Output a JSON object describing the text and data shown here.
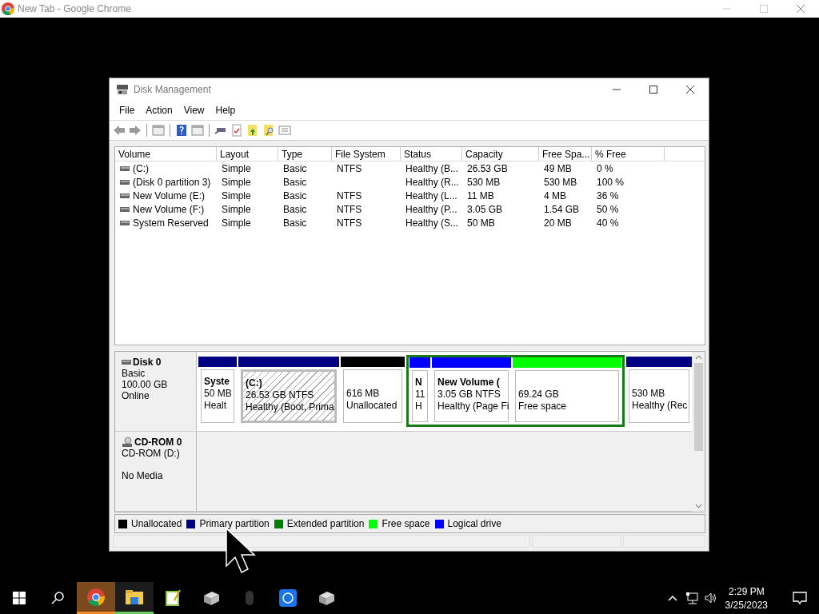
{
  "browser": {
    "title": "New Tab - Google Chrome"
  },
  "window": {
    "title": "Disk Management"
  },
  "menu": [
    "File",
    "Action",
    "View",
    "Help"
  ],
  "volume_list": {
    "columns": [
      "Volume",
      "Layout",
      "Type",
      "File System",
      "Status",
      "Capacity",
      "Free Spa...",
      "% Free"
    ],
    "rows": [
      [
        "(C:)",
        "Simple",
        "Basic",
        "NTFS",
        "Healthy (B...",
        "26.53 GB",
        "49 MB",
        "0 %"
      ],
      [
        "(Disk 0 partition 3)",
        "Simple",
        "Basic",
        "",
        "Healthy (R...",
        "530 MB",
        "530 MB",
        "100 %"
      ],
      [
        "New Volume (E:)",
        "Simple",
        "Basic",
        "NTFS",
        "Healthy (L...",
        "11 MB",
        "4 MB",
        "36 %"
      ],
      [
        "New Volume (F:)",
        "Simple",
        "Basic",
        "NTFS",
        "Healthy (P...",
        "3.05 GB",
        "1.54 GB",
        "50 %"
      ],
      [
        "System Reserved",
        "Simple",
        "Basic",
        "NTFS",
        "Healthy (S...",
        "50 MB",
        "20 MB",
        "40 %"
      ]
    ]
  },
  "disks": [
    {
      "kind": "disk",
      "name": "Disk 0",
      "lines": [
        "Basic",
        "100.00 GB",
        "Online"
      ],
      "partitions": [
        {
          "kind": "primary",
          "selected": false,
          "name": "Syste",
          "lines": [
            "50 MB",
            "Healt"
          ]
        },
        {
          "kind": "primary",
          "selected": true,
          "name": "(C:)",
          "lines": [
            "26.53 GB NTFS",
            "Healthy (Boot, Prima"
          ]
        },
        {
          "kind": "unallocated",
          "selected": false,
          "lines": [
            "616 MB",
            "Unallocated"
          ]
        },
        {
          "kind": "extended",
          "children": [
            {
              "kind": "logical",
              "selected": false,
              "name": "N",
              "lines": [
                "11",
                "H"
              ]
            },
            {
              "kind": "logical",
              "selected": false,
              "name": "New Volume (",
              "lines": [
                "3.05 GB NTFS",
                "Healthy (Page Fi"
              ]
            },
            {
              "kind": "free",
              "selected": false,
              "lines": [
                "69.24 GB",
                "Free space"
              ]
            }
          ]
        },
        {
          "kind": "primary",
          "selected": false,
          "lines": [
            "530 MB",
            "Healthy (Rec"
          ]
        }
      ]
    },
    {
      "kind": "cdrom",
      "name": "CD-ROM 0",
      "drive": "CD-ROM (D:)",
      "status": "No Media"
    }
  ],
  "legend": [
    {
      "label": "Unallocated",
      "color": "#000000"
    },
    {
      "label": "Primary partition",
      "color": "#000080"
    },
    {
      "label": "Extended partition",
      "color": "#008000"
    },
    {
      "label": "Free space",
      "color": "#00ff00"
    },
    {
      "label": "Logical drive",
      "color": "#0000ff"
    }
  ],
  "taskbar": {
    "time": "2:29 PM",
    "date": "3/25/2023"
  }
}
